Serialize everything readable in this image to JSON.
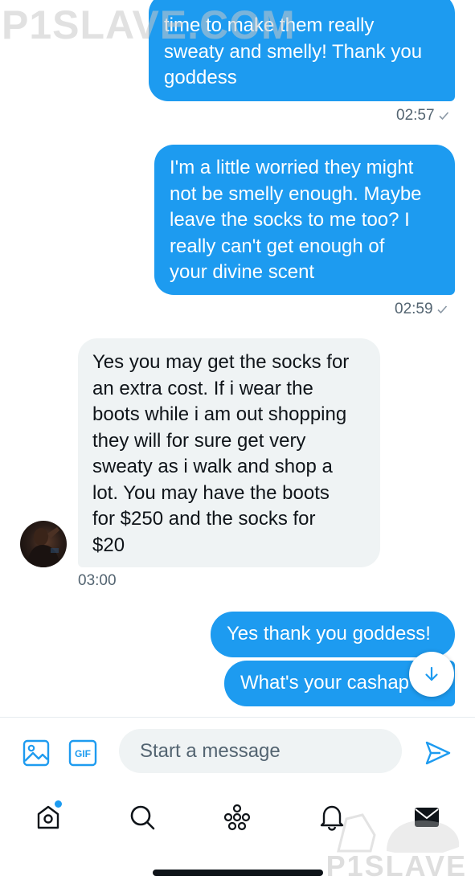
{
  "watermark": {
    "top": "P1SLAVE.COM",
    "bottom": "P1SLAVE"
  },
  "messages": [
    {
      "direction": "out",
      "text": "time to make them really\nsweaty and smelly! Thank you\ngoddess",
      "time": "02:57"
    },
    {
      "direction": "out",
      "text": "I'm a little worried they might\nnot be smelly enough. Maybe\nleave the socks to me too? I\nreally can't get enough of\nyour divine scent",
      "time": "02:59"
    },
    {
      "direction": "in",
      "text": "Yes you may get the socks for\nan extra cost. If i wear the\nboots while i am out shopping\nthey will for sure get very\nsweaty as i walk and shop a\nlot. You may have the boots\nfor $250 and the socks for\n$20",
      "time": "03:00"
    },
    {
      "direction": "out",
      "text": "Yes thank you goddess!"
    },
    {
      "direction": "out",
      "text": "What's your cashap"
    }
  ],
  "composer": {
    "placeholder": "Start a message",
    "icons": [
      "image-icon",
      "gif-icon",
      "send-icon"
    ],
    "gif_label": "GIF"
  },
  "nav": {
    "tabs": [
      "home",
      "search",
      "spaces",
      "notifications",
      "messages"
    ],
    "home_has_badge": true
  },
  "colors": {
    "accent": "#1d9bf0",
    "incoming_bubble": "#eff3f4"
  }
}
